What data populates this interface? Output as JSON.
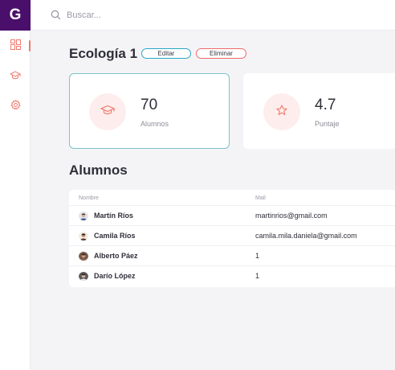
{
  "app": {
    "logo_letter": "G"
  },
  "search": {
    "placeholder": "Buscar..."
  },
  "course": {
    "title": "Ecología 1",
    "edit_label": "Editar",
    "delete_label": "Eliminar"
  },
  "stats": [
    {
      "value": "70",
      "label": "Alumnos",
      "icon": "graduation-cap-icon"
    },
    {
      "value": "4.7",
      "label": "Puntaje",
      "icon": "star-icon"
    }
  ],
  "students": {
    "title": "Alumnos",
    "columns": [
      "Nombre",
      "Mail"
    ],
    "rows": [
      {
        "name": "Martín Ríos",
        "mail": "martinrios@gmail.com"
      },
      {
        "name": "Camila Ríos",
        "mail": "camila.mila.daniela@gmail.com"
      },
      {
        "name": "Alberto Páez",
        "mail": "1"
      },
      {
        "name": "Darío López",
        "mail": "1"
      }
    ]
  },
  "colors": {
    "brand": "#4a0e6b",
    "accent": "#f07a6e",
    "edit_border": "#2aa8c4",
    "delete_border": "#f06a6a"
  }
}
